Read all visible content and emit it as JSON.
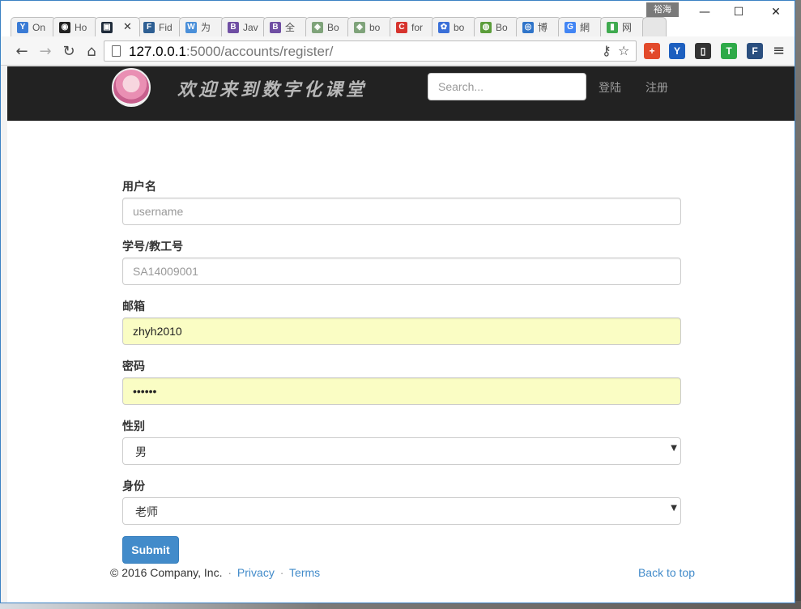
{
  "browser": {
    "profile_name": "裕海",
    "tabs": [
      {
        "title": "On",
        "fav": "Y",
        "color": "#3a7bd5",
        "active": false
      },
      {
        "title": "Ho",
        "fav": "◉",
        "color": "#222222",
        "active": false
      },
      {
        "title": "",
        "fav": "▣",
        "color": "#1f2b3a",
        "active": true
      },
      {
        "title": "Fid",
        "fav": "F",
        "color": "#2e5f93",
        "active": false
      },
      {
        "title": "为",
        "fav": "W",
        "color": "#4a8fd9",
        "active": false
      },
      {
        "title": "Jav",
        "fav": "B",
        "color": "#6f4ea3",
        "active": false
      },
      {
        "title": "全",
        "fav": "B",
        "color": "#6f4ea3",
        "active": false
      },
      {
        "title": "Bo",
        "fav": "◈",
        "color": "#7fa37a",
        "active": false
      },
      {
        "title": "bo",
        "fav": "◈",
        "color": "#7fa37a",
        "active": false
      },
      {
        "title": "for",
        "fav": "C",
        "color": "#d6332d",
        "active": false
      },
      {
        "title": "bo",
        "fav": "✿",
        "color": "#3a6fd8",
        "active": false
      },
      {
        "title": "Bo",
        "fav": "◍",
        "color": "#5b9d3a",
        "active": false
      },
      {
        "title": "博",
        "fav": "◎",
        "color": "#2f74c9",
        "active": false
      },
      {
        "title": "網",
        "fav": "G",
        "color": "#4285f4",
        "active": false
      },
      {
        "title": "网",
        "fav": "▮",
        "color": "#3faa4f",
        "active": false
      }
    ],
    "url_host": "127.0.0.1",
    "url_rest": ":5000/accounts/register/",
    "extensions": [
      {
        "label": "+",
        "color": "#e24a2b"
      },
      {
        "label": "Y",
        "color": "#1d5fbf"
      },
      {
        "label": "▯",
        "color": "#333333"
      },
      {
        "label": "T",
        "color": "#2eaa48"
      },
      {
        "label": "F",
        "color": "#2b4f7f"
      }
    ]
  },
  "navbar": {
    "brand": "欢迎来到数字化课堂",
    "search_placeholder": "Search...",
    "login": "登陆",
    "register": "注册"
  },
  "form": {
    "username_label": "用户名",
    "username_placeholder": "username",
    "student_id_label": "学号/教工号",
    "student_id_placeholder": "SA14009001",
    "email_label": "邮箱",
    "email_value": "zhyh2010",
    "password_label": "密码",
    "password_value": "••••••",
    "gender_label": "性别",
    "gender_value": "男",
    "role_label": "身份",
    "role_value": "老师",
    "submit": "Submit"
  },
  "footer": {
    "copyright": "© 2016 Company, Inc.",
    "sep": "·",
    "privacy": "Privacy",
    "terms": "Terms",
    "back_to_top": "Back to top"
  }
}
